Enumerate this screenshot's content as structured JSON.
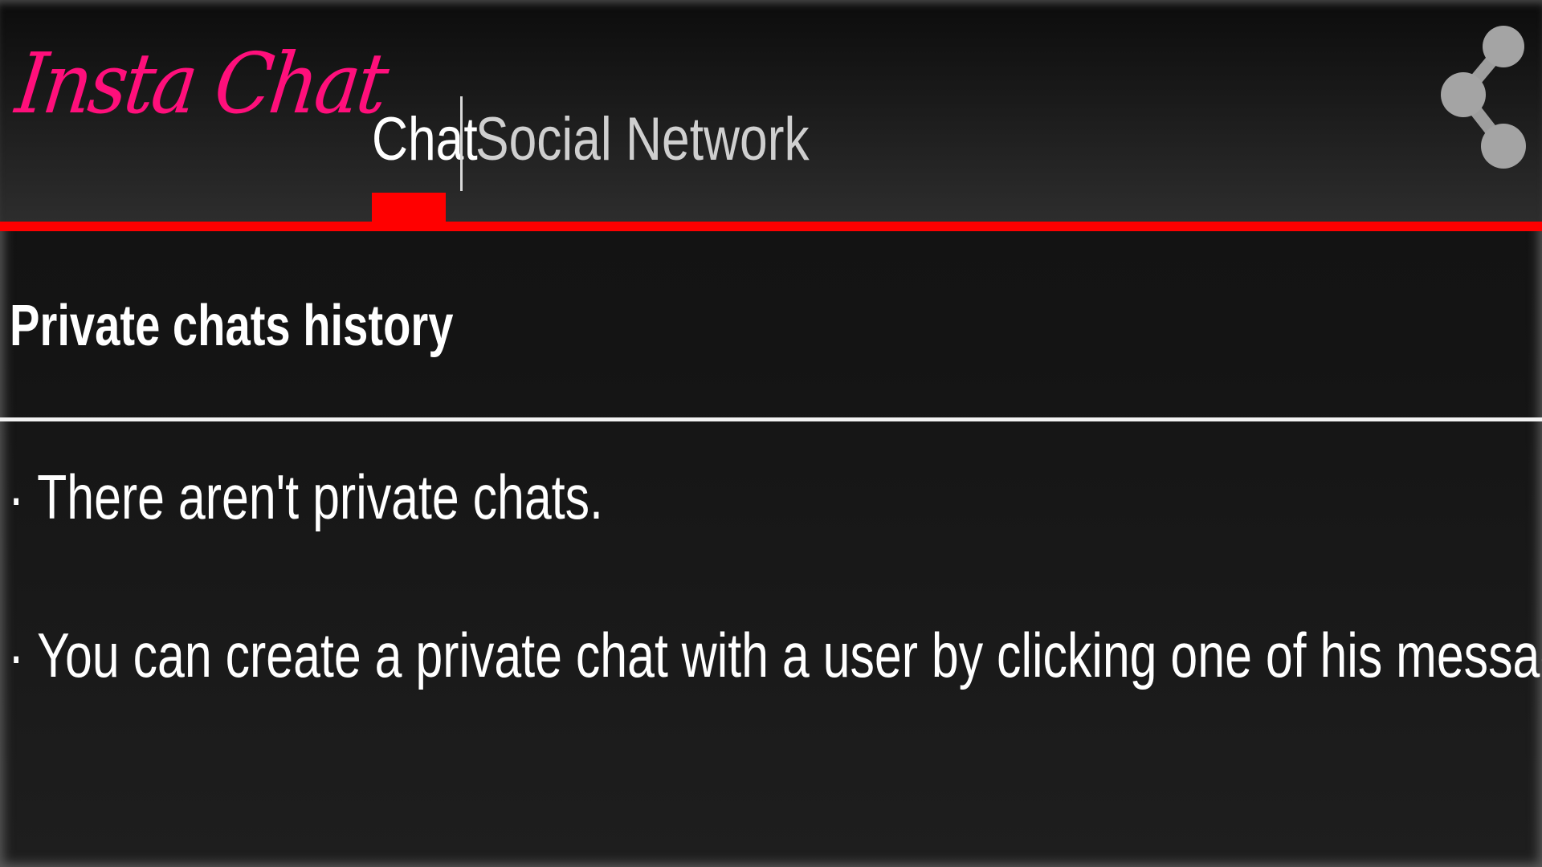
{
  "app": {
    "logo_text": "Insta Chat",
    "accent_color": "#ff0000",
    "logo_color": "#ff0f7b"
  },
  "tabs": [
    {
      "label": "Chat",
      "selected": true
    },
    {
      "label": "Social Network",
      "selected": false
    }
  ],
  "toolbar": {
    "share_icon": "share-icon"
  },
  "section": {
    "title": "Private chats history"
  },
  "messages": [
    "· There aren't private chats.",
    "· You can create a private chat with a user by clicking one of his messages."
  ]
}
